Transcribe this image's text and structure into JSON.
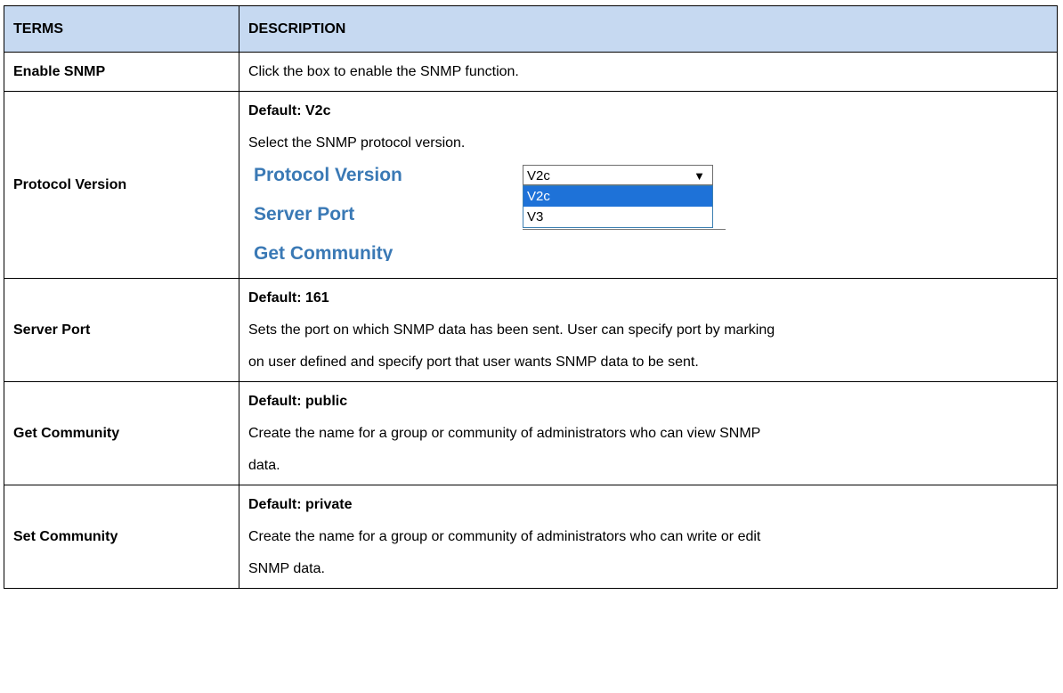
{
  "headers": {
    "terms": "TERMS",
    "description": "DESCRIPTION"
  },
  "rows": {
    "enable_snmp": {
      "term": "Enable SNMP",
      "lines": [
        "Click the box to enable the SNMP function."
      ]
    },
    "protocol_version": {
      "term": "Protocol Version",
      "default": "Default: V2c",
      "lines": [
        "Select the SNMP protocol version."
      ],
      "screenshot": {
        "label_protocol": "Protocol Version",
        "label_server_port": "Server Port",
        "label_partial": "Get Community",
        "selected_value": "V2c",
        "options": [
          "V2c",
          "V3"
        ]
      }
    },
    "server_port": {
      "term": "Server Port",
      "default": "Default: 161",
      "lines": [
        "Sets the port on which SNMP data has been sent. User can specify port by marking",
        "on user defined and specify port that user wants SNMP data to be sent."
      ]
    },
    "get_community": {
      "term": "Get Community",
      "default": "Default: public",
      "lines": [
        "Create the name for a group or community of administrators who can view SNMP",
        "data."
      ]
    },
    "set_community": {
      "term": "Set Community",
      "default": "Default: private",
      "lines": [
        "Create the name for a group or community of administrators who can write or edit",
        "SNMP data."
      ]
    }
  },
  "colors": {
    "header_bg": "#c6d9f1",
    "label_blue": "#3a79b5",
    "highlight": "#1e72d8"
  },
  "icons": {
    "dropdown": "dropdown-arrow-icon"
  }
}
